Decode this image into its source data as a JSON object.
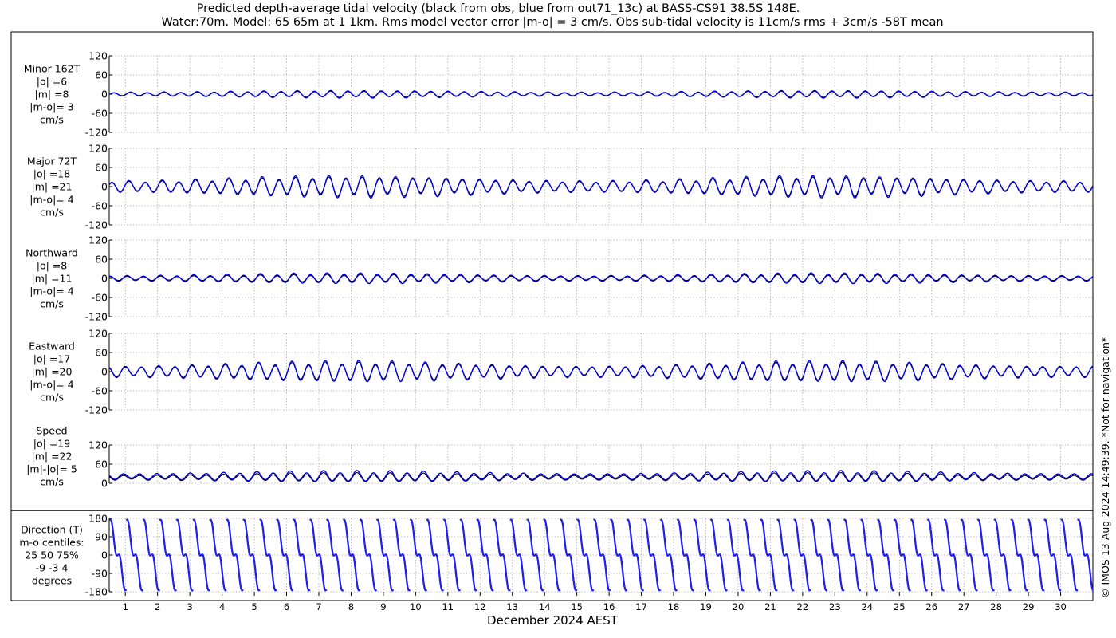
{
  "title_line1": "Predicted depth-average tidal velocity (black from obs, blue from out71_13c) at BASS-CS91 38.5S 148E.",
  "title_line2": "Water:70m. Model: 65 65m at 1 1km. Rms model vector error |m-o| = 3 cm/s. Obs sub-tidal velocity is 11cm/s rms + 3cm/s -58T mean",
  "side_note": "© IMOS 13-Aug-2024 14:49:39. *Not for navigation*",
  "xlabel": "December 2024 AEST",
  "colors": {
    "obs": "#000000",
    "model": "#0000dd",
    "model_direction": "#1f1fff",
    "grid": "#999999"
  },
  "chart_data": [
    {
      "type": "line",
      "id": "minor",
      "label_lines": [
        "Minor 162T",
        "|o| =6",
        "|m| =8",
        "|m-o|= 3",
        "cm/s"
      ],
      "ylim": [
        -120,
        120
      ],
      "yticks": [
        -120,
        -60,
        0,
        60,
        120
      ],
      "x_range": [
        0.5,
        31.0
      ],
      "series": [
        {
          "name": "obs",
          "mean": 0,
          "amplitude": 8,
          "semidiurnal_share": 1.0,
          "diurnal_share": 0.2
        },
        {
          "name": "model",
          "mean": 0,
          "amplitude": 10,
          "semidiurnal_share": 1.0,
          "diurnal_share": 0.2
        }
      ]
    },
    {
      "type": "line",
      "id": "major",
      "label_lines": [
        "Major 72T",
        "|o| =18",
        "|m| =21",
        "|m-o|= 4",
        "cm/s"
      ],
      "ylim": [
        -120,
        120
      ],
      "yticks": [
        -120,
        -60,
        0,
        60,
        120
      ],
      "x_range": [
        0.5,
        31.0
      ],
      "series": [
        {
          "name": "obs",
          "mean": 0,
          "amplitude": 25,
          "semidiurnal_share": 1.0,
          "diurnal_share": 0.2
        },
        {
          "name": "model",
          "mean": 0,
          "amplitude": 29,
          "semidiurnal_share": 1.0,
          "diurnal_share": 0.2
        }
      ]
    },
    {
      "type": "line",
      "id": "northward",
      "label_lines": [
        "Northward",
        "|o| =8",
        "|m| =11",
        "|m-o|= 4",
        "cm/s"
      ],
      "ylim": [
        -120,
        120
      ],
      "yticks": [
        -120,
        -60,
        0,
        60,
        120
      ],
      "x_range": [
        0.5,
        31.0
      ],
      "series": [
        {
          "name": "obs",
          "mean": 0,
          "amplitude": 10,
          "semidiurnal_share": 1.0,
          "diurnal_share": 0.2
        },
        {
          "name": "model",
          "mean": 0,
          "amplitude": 14,
          "semidiurnal_share": 1.0,
          "diurnal_share": 0.2
        }
      ]
    },
    {
      "type": "line",
      "id": "eastward",
      "label_lines": [
        "Eastward",
        "|o| =17",
        "|m| =20",
        "|m-o|= 4",
        "cm/s"
      ],
      "ylim": [
        -120,
        120
      ],
      "yticks": [
        -120,
        -60,
        0,
        60,
        120
      ],
      "x_range": [
        0.5,
        31.0
      ],
      "series": [
        {
          "name": "obs",
          "mean": 0,
          "amplitude": 24,
          "semidiurnal_share": 1.0,
          "diurnal_share": 0.2
        },
        {
          "name": "model",
          "mean": 0,
          "amplitude": 28,
          "semidiurnal_share": 1.0,
          "diurnal_share": 0.2
        }
      ]
    },
    {
      "type": "line",
      "id": "speed",
      "label_lines": [
        "Speed",
        "|o| =19",
        "|m| =22",
        "|m|-|o|= 5",
        "cm/s"
      ],
      "ylim": [
        0,
        120
      ],
      "yticks": [
        0,
        60,
        120
      ],
      "x_range": [
        0.5,
        31.0
      ],
      "series": [
        {
          "name": "obs",
          "mean": 18,
          "amplitude": 12,
          "semidiurnal_share": 1.0,
          "diurnal_share": 0.25
        },
        {
          "name": "model",
          "mean": 22,
          "amplitude": 14,
          "semidiurnal_share": 1.0,
          "diurnal_share": 0.25
        }
      ]
    },
    {
      "type": "scatter",
      "id": "direction",
      "label_lines": [
        "Direction (T)",
        "m-o centiles:",
        "25  50  75%",
        "-9 -3  4",
        "degrees"
      ],
      "ylim": [
        -180,
        180
      ],
      "yticks": [
        -180,
        -90,
        0,
        90,
        180
      ],
      "x_range": [
        0.5,
        31.0
      ],
      "xticks": [
        1,
        2,
        3,
        4,
        5,
        6,
        7,
        8,
        9,
        10,
        11,
        12,
        13,
        14,
        15,
        16,
        17,
        18,
        19,
        20,
        21,
        22,
        23,
        24,
        25,
        26,
        27,
        28,
        29,
        30
      ],
      "series": [
        {
          "name": "obs",
          "period_days": 0.5175
        },
        {
          "name": "model",
          "period_days": 0.5175
        }
      ]
    }
  ]
}
